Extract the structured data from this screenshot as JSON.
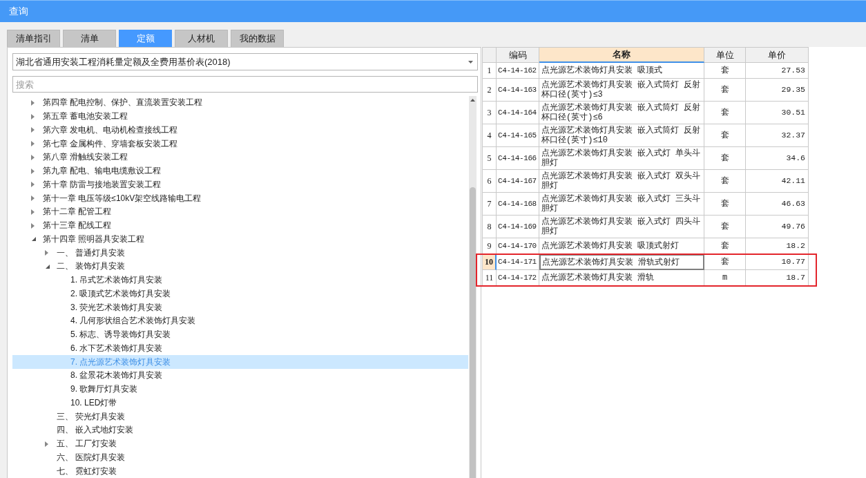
{
  "window": {
    "title": "查询"
  },
  "tabs": [
    {
      "label": "清单指引",
      "selected": false
    },
    {
      "label": "清单",
      "selected": false
    },
    {
      "label": "定额",
      "selected": true
    },
    {
      "label": "人材机",
      "selected": false
    },
    {
      "label": "我的数据",
      "selected": false
    }
  ],
  "library_select": {
    "value": "湖北省通用安装工程消耗量定额及全费用基价表(2018)"
  },
  "search": {
    "placeholder": "搜索"
  },
  "tree": [
    {
      "label": "第四章 配电控制、保护、直流装置安装工程",
      "expanded": false,
      "selected": false
    },
    {
      "label": "第五章 蓄电池安装工程",
      "expanded": false,
      "selected": false
    },
    {
      "label": "第六章 发电机、电动机检查接线工程",
      "expanded": false,
      "selected": false
    },
    {
      "label": "第七章 金属构件、穿墙套板安装工程",
      "expanded": false,
      "selected": false
    },
    {
      "label": "第八章 滑触线安装工程",
      "expanded": false,
      "selected": false
    },
    {
      "label": "第九章 配电、输电电缆敷设工程",
      "expanded": false,
      "selected": false
    },
    {
      "label": "第十章 防雷与接地装置安装工程",
      "expanded": false,
      "selected": false
    },
    {
      "label": "第十一章 电压等级≤10kV架空线路输电工程",
      "expanded": false,
      "selected": false
    },
    {
      "label": "第十二章 配管工程",
      "expanded": false,
      "selected": false
    },
    {
      "label": "第十三章 配线工程",
      "expanded": false,
      "selected": false
    },
    {
      "label": "第十四章 照明器具安装工程",
      "expanded": true,
      "selected": false,
      "children": [
        {
          "label": "一、 普通灯具安装",
          "expanded": false,
          "selected": false
        },
        {
          "label": "二、 装饰灯具安装",
          "expanded": true,
          "selected": false,
          "children": [
            {
              "label": "1. 吊式艺术装饰灯具安装",
              "selected": false
            },
            {
              "label": "2. 吸顶式艺术装饰灯具安装",
              "selected": false
            },
            {
              "label": "3. 荧光艺术装饰灯具安装",
              "selected": false
            },
            {
              "label": "4. 几何形状组合艺术装饰灯具安装",
              "selected": false
            },
            {
              "label": "5. 标志、诱导装饰灯具安装",
              "selected": false
            },
            {
              "label": "6. 水下艺术装饰灯具安装",
              "selected": false
            },
            {
              "label": "7. 点光源艺术装饰灯具安装",
              "selected": true
            },
            {
              "label": "8. 盆景花木装饰灯具安装",
              "selected": false
            },
            {
              "label": "9. 歌舞厅灯具安装",
              "selected": false
            },
            {
              "label": "10. LED灯带",
              "selected": false
            }
          ]
        },
        {
          "label": "三、 荧光灯具安装",
          "selected": false
        },
        {
          "label": "四、 嵌入式地灯安装",
          "selected": false
        },
        {
          "label": "五、 工厂灯安装",
          "expanded": false,
          "selected": false
        },
        {
          "label": "六、 医院灯具安装",
          "selected": false
        },
        {
          "label": "七、 霓虹灯安装",
          "selected": false
        }
      ]
    }
  ],
  "table": {
    "columns": [
      {
        "label": "编码",
        "selected": false
      },
      {
        "label": "名称",
        "selected": true
      },
      {
        "label": "单位",
        "selected": false
      },
      {
        "label": "单价",
        "selected": false
      }
    ],
    "rows": [
      {
        "number": "1",
        "code": "C4-14-162",
        "name": "点光源艺术装饰灯具安装 吸顶式",
        "unit": "套",
        "price": "27.53",
        "selected": false,
        "marked": false
      },
      {
        "number": "2",
        "code": "C4-14-163",
        "name": "点光源艺术装饰灯具安装 嵌入式筒灯 反射杯口径(英寸)≤3",
        "unit": "套",
        "price": "29.35",
        "selected": false,
        "marked": false
      },
      {
        "number": "3",
        "code": "C4-14-164",
        "name": "点光源艺术装饰灯具安装 嵌入式筒灯 反射杯口径(英寸)≤6",
        "unit": "套",
        "price": "30.51",
        "selected": false,
        "marked": false
      },
      {
        "number": "4",
        "code": "C4-14-165",
        "name": "点光源艺术装饰灯具安装 嵌入式筒灯 反射杯口径(英寸)≤10",
        "unit": "套",
        "price": "32.37",
        "selected": false,
        "marked": false
      },
      {
        "number": "5",
        "code": "C4-14-166",
        "name": "点光源艺术装饰灯具安装 嵌入式灯 单头斗胆灯",
        "unit": "套",
        "price": "34.6",
        "selected": false,
        "marked": false
      },
      {
        "number": "6",
        "code": "C4-14-167",
        "name": "点光源艺术装饰灯具安装 嵌入式灯 双头斗胆灯",
        "unit": "套",
        "price": "42.11",
        "selected": false,
        "marked": false
      },
      {
        "number": "7",
        "code": "C4-14-168",
        "name": "点光源艺术装饰灯具安装 嵌入式灯 三头斗胆灯",
        "unit": "套",
        "price": "46.63",
        "selected": false,
        "marked": false
      },
      {
        "number": "8",
        "code": "C4-14-169",
        "name": "点光源艺术装饰灯具安装 嵌入式灯 四头斗胆灯",
        "unit": "套",
        "price": "49.76",
        "selected": false,
        "marked": false
      },
      {
        "number": "9",
        "code": "C4-14-170",
        "name": "点光源艺术装饰灯具安装 吸顶式射灯",
        "unit": "套",
        "price": "18.2",
        "selected": false,
        "marked": false
      },
      {
        "number": "10",
        "code": "C4-14-171",
        "name": "点光源艺术装饰灯具安装 滑轨式射灯",
        "unit": "套",
        "price": "10.77",
        "selected": true,
        "marked": true
      },
      {
        "number": "11",
        "code": "C4-14-172",
        "name": "点光源艺术装饰灯具安装 滑轨",
        "unit": "m",
        "price": "18.7",
        "selected": false,
        "marked": true
      }
    ]
  }
}
